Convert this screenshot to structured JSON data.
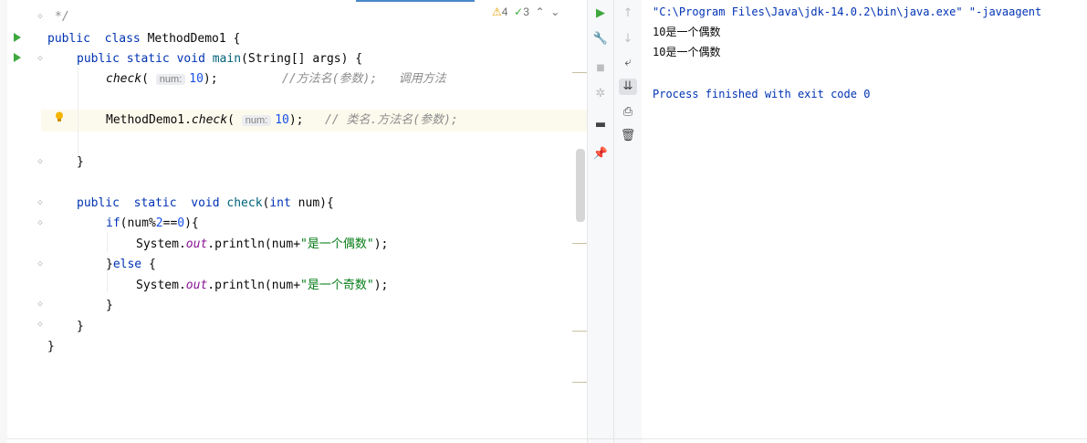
{
  "editor": {
    "status": {
      "warnings": "4",
      "weak_warnings": "3",
      "up_arrow": "^",
      "down_arrow": "v"
    },
    "lines": {
      "l0": "*/",
      "l1_kw1": "public",
      "l1_kw2": "class",
      "l1_rest": " MethodDemo1 {",
      "l2_kw1": "public",
      "l2_kw2": "static",
      "l2_kw3": "void",
      "l2_fn": "main",
      "l2_rest": "(String[] args) {",
      "l3_call": "check",
      "l3_paren": "(",
      "l3_hint": "num:",
      "l3_num": "10",
      "l3_end": ");",
      "l3_cmt": "//方法名(参数);   调用方法",
      "l5_cls": "MethodDemo1.",
      "l5_call": "check",
      "l5_paren": "(",
      "l5_hint": "num:",
      "l5_num": "10",
      "l5_end": ");",
      "l5_cmt": "// 类名.方法名(参数);",
      "l7": "}",
      "l9_kw1": "public",
      "l9_kw2": "static",
      "l9_kw3": "void",
      "l9_fn": "check",
      "l9_p1": "(",
      "l9_kw4": "int",
      "l9_rest": " num){",
      "l10_kw": "if",
      "l10_a": "(num%",
      "l10_n1": "2",
      "l10_b": "==",
      "l10_n2": "0",
      "l10_c": "){",
      "l11_a": "System.",
      "l11_field": "out",
      "l11_b": ".println(num+",
      "l11_str": "\"是一个偶数\"",
      "l11_c": ");",
      "l12_a": "}",
      "l12_kw": "else",
      "l12_b": " {",
      "l13_a": "System.",
      "l13_field": "out",
      "l13_b": ".println(num+",
      "l13_str": "\"是一个奇数\"",
      "l13_c": ");",
      "l14": "}",
      "l15": "}",
      "l16": "}"
    }
  },
  "toolbar": {
    "run_icon": "rerun-icon",
    "settings_icon": "wrench-icon",
    "stop_icon": "stop-icon",
    "debug_icon": "bug-icon",
    "layout_icon": "layout-icon",
    "pin_icon": "pin-icon",
    "up_icon": "up-arrow-icon",
    "down_icon": "down-arrow-icon",
    "wrap_icon": "soft-wrap-icon",
    "scroll_end_icon": "scroll-to-end-icon",
    "print_icon": "print-icon",
    "trash_icon": "trash-icon"
  },
  "console": {
    "command": "\"C:\\Program Files\\Java\\jdk-14.0.2\\bin\\java.exe\" \"-javaagent",
    "out1": "10是一个偶数",
    "out2": "10是一个偶数",
    "exit": "Process finished with exit code 0"
  },
  "colors": {
    "keyword": "#0033b3",
    "string": "#067d17",
    "number": "#1750eb",
    "comment": "#8c8c8c",
    "run": "#3ea83e"
  }
}
